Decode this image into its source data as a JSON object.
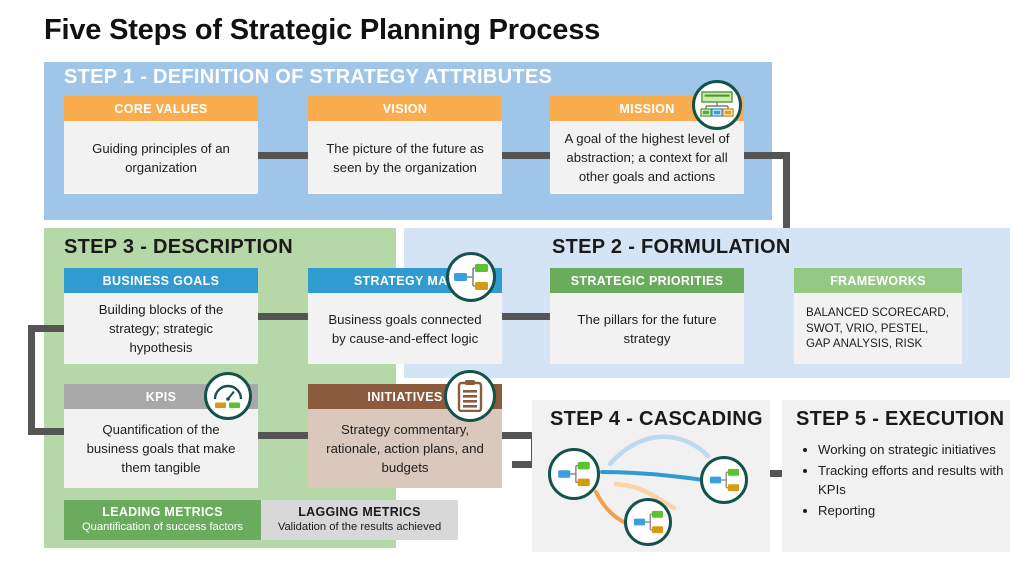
{
  "page": {
    "title": "Five Steps of Strategic Planning Process"
  },
  "colors": {
    "step1_bg": "#9fc6e9",
    "step2_bg": "#d5e4f4",
    "step3_bg": "#b6d7a8",
    "step4_bg": "#f1f1f1",
    "step5_bg": "#f1f1f1",
    "orange_header": "#f9ad4e",
    "blue_header": "#2f9bd0",
    "green_header": "#6aab5e",
    "green_light_header": "#94c983",
    "gray_header": "#a8a8a8",
    "brown_header": "#8c5a3c",
    "connector": "#555555",
    "icon_ring": "#13524d"
  },
  "steps": {
    "step1": {
      "heading": "STEP 1 - DEFINITION OF STRATEGY ATTRIBUTES",
      "cards": [
        {
          "title": "CORE VALUES",
          "body": "Guiding principles of an organization"
        },
        {
          "title": "VISION",
          "body": "The picture of the future as seen by the organization"
        },
        {
          "title": "MISSION",
          "body": "A goal of the highest level of abstraction; a context for all other goals and actions",
          "icon": "org-chart-icon"
        }
      ]
    },
    "step2": {
      "heading": "STEP 2 - FORMULATION",
      "cards": [
        {
          "title": "STRATEGIC PRIORITIES",
          "body": "The pillars for the future strategy"
        },
        {
          "title": "FRAMEWORKS",
          "body": "BALANCED SCORECARD, SWOT, VRIO, PESTEL, GAP ANALYSIS, RISK"
        }
      ]
    },
    "step3": {
      "heading": "STEP 3 - DESCRIPTION",
      "cards": [
        {
          "title": "BUSINESS GOALS",
          "body": "Building blocks of the strategy; strategic hypothesis"
        },
        {
          "title": "STRATEGY MAP",
          "body": "Business goals connected by cause-and-effect logic",
          "icon": "strategy-map-icon"
        },
        {
          "title": "KPIS",
          "body": "Quantification of the business goals that make them tangible",
          "icon": "gauge-icon"
        },
        {
          "title": "INITIATIVES",
          "body": "Strategy commentary, rationale, action plans, and budgets",
          "icon": "clipboard-icon"
        }
      ],
      "metrics": [
        {
          "title": "LEADING METRICS",
          "subtitle": "Quantification of success factors"
        },
        {
          "title": "LAGGING METRICS",
          "subtitle": "Validation of the results achieved"
        }
      ]
    },
    "step4": {
      "heading": "STEP 4 - CASCADING",
      "diagram_icons": [
        "strategy-map-icon",
        "strategy-map-icon",
        "strategy-map-icon"
      ]
    },
    "step5": {
      "heading": "STEP 5 - EXECUTION",
      "bullets": [
        "Working on strategic initiatives",
        "Tracking efforts and results with KPIs",
        "Reporting"
      ]
    }
  }
}
